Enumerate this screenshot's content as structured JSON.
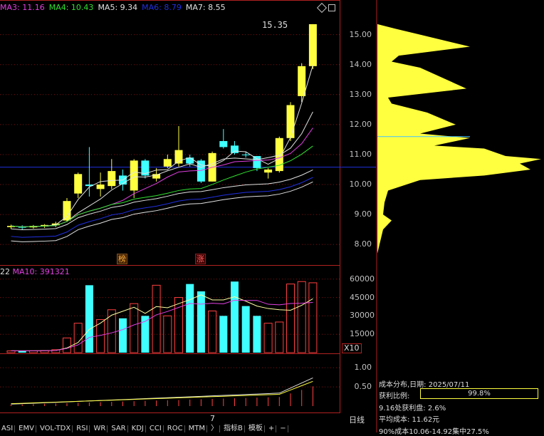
{
  "ma_legend": [
    {
      "label": "MA3: 11.16",
      "color": "#e040e0"
    },
    {
      "label": "MA4: 10.43",
      "color": "#30e030"
    },
    {
      "label": "MA5: 9.34",
      "color": "#e0e0e0"
    },
    {
      "label": "MA6: 8.79",
      "color": "#2030e0"
    },
    {
      "label": "MA7: 8.55",
      "color": "#e0e0e0"
    }
  ],
  "top_right_icons": [
    "diamond-icon",
    "square-icon"
  ],
  "price_axis": [
    "15.00",
    "14.00",
    "13.00",
    "12.00",
    "11.00",
    "10.00",
    "9.00",
    "8.00"
  ],
  "high_label": "15.35",
  "markers": [
    "榜",
    "涨"
  ],
  "volume_legend": {
    "prefix": "22",
    "ma10": "MA10: 391321"
  },
  "volume_axis": [
    "60000",
    "45000",
    "30000",
    "15000"
  ],
  "volume_unit": "X10",
  "profit_axis": [
    "1.00",
    "0.50"
  ],
  "x_tick": "7",
  "cost_info": {
    "title": "成本分布,日期: 2025/07/11",
    "ratio_label": "获利比例:",
    "ratio_value": "99.8%",
    "line2": "9.16处获利盘: 2.6%",
    "line3": "平均成本: 11.62元",
    "line4": "90%成本10.06-14.92集中27.5%"
  },
  "period_label": "日线",
  "tabs": [
    "ASI",
    "EMV",
    "VOL-TDX",
    "RSI",
    "WR",
    "SAR",
    "KDJ",
    "CCI",
    "ROC",
    "MTM",
    "〉",
    "指标B",
    "模板",
    "+",
    "−"
  ],
  "colors": {
    "up": "#ffff40",
    "down": "#40ffff",
    "bull_hollow": "#ff4040"
  },
  "chart_data": {
    "type": "candlestick",
    "candles": [
      {
        "o": 8.58,
        "c": 8.62,
        "h": 8.66,
        "l": 8.52
      },
      {
        "o": 8.6,
        "c": 8.56,
        "h": 8.64,
        "l": 8.5
      },
      {
        "o": 8.57,
        "c": 8.62,
        "h": 8.65,
        "l": 8.53
      },
      {
        "o": 8.6,
        "c": 8.65,
        "h": 8.68,
        "l": 8.55
      },
      {
        "o": 8.64,
        "c": 8.7,
        "h": 8.76,
        "l": 8.58
      },
      {
        "o": 8.8,
        "c": 9.45,
        "h": 9.55,
        "l": 8.75
      },
      {
        "o": 9.7,
        "c": 10.35,
        "h": 10.4,
        "l": 9.55
      },
      {
        "o": 10.0,
        "c": 9.95,
        "h": 11.25,
        "l": 9.6
      },
      {
        "o": 9.85,
        "c": 10.0,
        "h": 10.4,
        "l": 9.6
      },
      {
        "o": 9.95,
        "c": 10.45,
        "h": 10.85,
        "l": 9.85
      },
      {
        "o": 10.3,
        "c": 10.0,
        "h": 10.5,
        "l": 9.8
      },
      {
        "o": 9.8,
        "c": 10.8,
        "h": 10.85,
        "l": 9.55
      },
      {
        "o": 10.8,
        "c": 10.3,
        "h": 10.85,
        "l": 10.2
      },
      {
        "o": 10.2,
        "c": 10.35,
        "h": 10.55,
        "l": 10.1
      },
      {
        "o": 10.6,
        "c": 10.85,
        "h": 11.0,
        "l": 10.55
      },
      {
        "o": 10.7,
        "c": 11.15,
        "h": 11.95,
        "l": 10.6
      },
      {
        "o": 10.9,
        "c": 10.7,
        "h": 11.0,
        "l": 10.6
      },
      {
        "o": 10.8,
        "c": 10.1,
        "h": 10.85,
        "l": 10.05
      },
      {
        "o": 10.1,
        "c": 11.05,
        "h": 11.1,
        "l": 10.1
      },
      {
        "o": 11.45,
        "c": 11.25,
        "h": 11.85,
        "l": 11.2
      },
      {
        "o": 11.3,
        "c": 11.05,
        "h": 11.45,
        "l": 11.0
      },
      {
        "o": 11.0,
        "c": 10.98,
        "h": 11.1,
        "l": 10.9
      },
      {
        "o": 10.95,
        "c": 10.55,
        "h": 10.95,
        "l": 10.45
      },
      {
        "o": 10.4,
        "c": 10.5,
        "h": 10.55,
        "l": 10.2
      },
      {
        "o": 10.45,
        "c": 11.55,
        "h": 11.6,
        "l": 10.4
      },
      {
        "o": 11.55,
        "c": 12.65,
        "h": 12.75,
        "l": 11.45
      },
      {
        "o": 12.95,
        "c": 13.95,
        "h": 14.05,
        "l": 12.75
      },
      {
        "o": 13.95,
        "c": 15.35,
        "h": 15.35,
        "l": 13.85
      }
    ],
    "volumes": [
      1500,
      1600,
      1500,
      1700,
      2400,
      12000,
      24000,
      55000,
      27000,
      35000,
      28000,
      40000,
      30000,
      55000,
      30000,
      45000,
      56000,
      50000,
      34000,
      30000,
      58000,
      38000,
      30000,
      24000,
      25000,
      56000,
      58000,
      57000
    ],
    "price_ylim": [
      7.6,
      15.8
    ],
    "volume_ylim": [
      0,
      68000
    ],
    "profit_ylim": [
      0,
      1.3
    ]
  }
}
